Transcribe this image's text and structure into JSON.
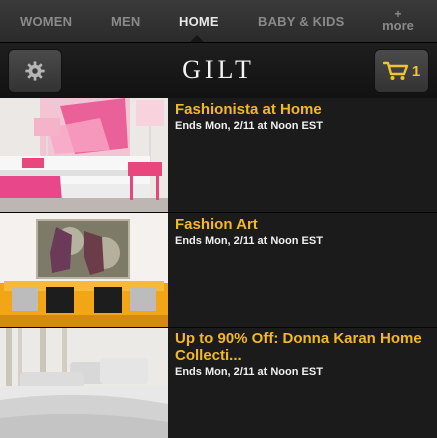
{
  "tabs": [
    {
      "label": "WOMEN",
      "active": false
    },
    {
      "label": "MEN",
      "active": false
    },
    {
      "label": "HOME",
      "active": true
    },
    {
      "label": "BABY & KIDS",
      "active": false
    }
  ],
  "more_tab": {
    "plus": "+",
    "label": "more"
  },
  "header": {
    "settings_icon": "gear-icon",
    "logo": "GILT",
    "cart_icon": "cart-icon",
    "cart_count": "1"
  },
  "colors": {
    "accent": "#f4b824",
    "background": "#1b1b1b",
    "tab_bar": "#333333"
  },
  "sales": [
    {
      "title": "Fashionista at Home",
      "ends": "Ends Mon, 2/11 at Noon EST"
    },
    {
      "title": "Fashion Art",
      "ends": "Ends Mon, 2/11 at Noon EST"
    },
    {
      "title": "Up to 90% Off: Donna Karan Home Collecti...",
      "ends": "Ends Mon, 2/11 at Noon EST"
    }
  ]
}
